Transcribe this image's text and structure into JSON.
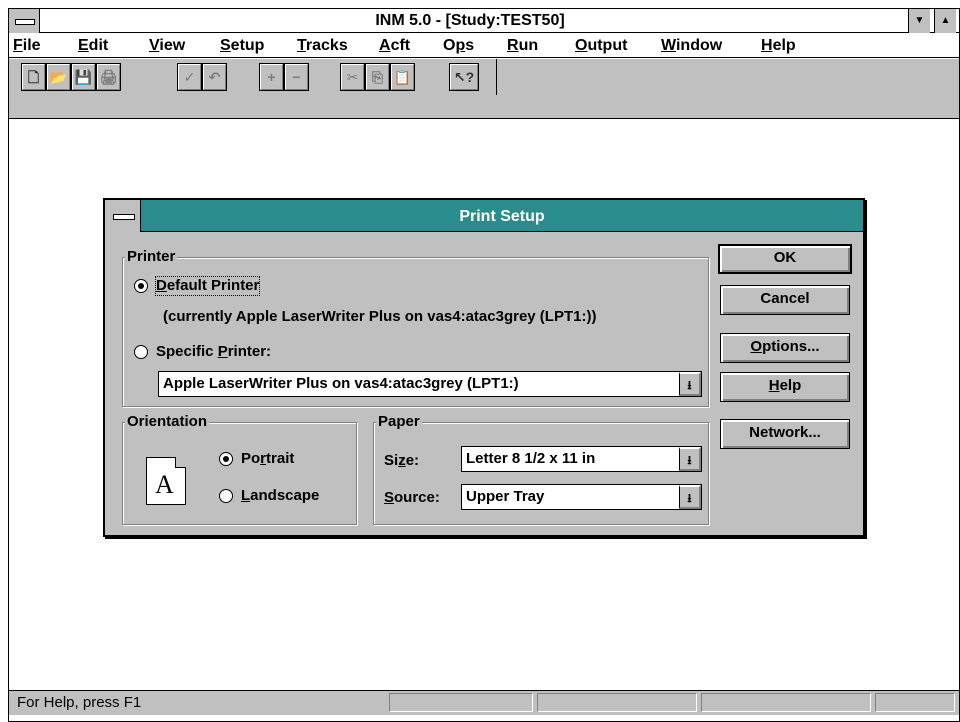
{
  "window": {
    "title": "INM 5.0 - [Study:TEST50]",
    "minimize_glyph": "▼",
    "maximize_glyph": "▲"
  },
  "menu": {
    "file": {
      "first": "F",
      "rest": "ile"
    },
    "edit": {
      "first": "E",
      "rest": "dit"
    },
    "view": {
      "first": "V",
      "rest": "iew"
    },
    "setup": {
      "first": "S",
      "rest": "etup"
    },
    "tracks": {
      "first": "T",
      "rest": "racks"
    },
    "acft": {
      "first": "A",
      "rest": "cft"
    },
    "ops": {
      "pre": "O",
      "u": "p",
      "rest": "s"
    },
    "run": {
      "first": "R",
      "rest": "un"
    },
    "output": {
      "first": "O",
      "rest": "utput"
    },
    "window": {
      "first": "W",
      "rest": "indow"
    },
    "help": {
      "first": "H",
      "rest": "elp"
    }
  },
  "toolbar": {
    "icons": {
      "new": "🗋",
      "open": "📂",
      "save": "💾",
      "print": "🖨",
      "check": "✓",
      "undo": "↶",
      "add": "+",
      "remove": "−",
      "cut": "✂",
      "copy": "⎘",
      "paste": "📋",
      "help": "↖?"
    }
  },
  "status": {
    "text": "For Help, press F1"
  },
  "dialog": {
    "title": "Print Setup",
    "printer_group": "Printer",
    "default_printer": {
      "first": "D",
      "rest": "efault Printer"
    },
    "currently": "(currently Apple LaserWriter Plus on vas4:atac3grey (LPT1:))",
    "specific_printer": {
      "pre": "Specific ",
      "u": "P",
      "rest": "rinter:"
    },
    "printer_select": "Apple LaserWriter Plus on vas4:atac3grey (LPT1:)",
    "orientation_group": "Orientation",
    "portrait": {
      "pre": "Po",
      "u": "r",
      "rest": "trait"
    },
    "landscape": {
      "first": "L",
      "rest": "andscape"
    },
    "orientation_icon_letter": "A",
    "paper_group": "Paper",
    "size_label": {
      "pre": "Si",
      "u": "z",
      "rest": "e:"
    },
    "size_value": "Letter 8 1/2 x 11 in",
    "source_label": {
      "first": "S",
      "rest": "ource:"
    },
    "source_value": "Upper Tray",
    "dropdown_glyph": "⭳",
    "buttons": {
      "ok": "OK",
      "cancel": "Cancel",
      "options": {
        "first": "O",
        "rest": "ptions..."
      },
      "help": {
        "first": "H",
        "rest": "elp"
      },
      "network": "Network..."
    }
  }
}
